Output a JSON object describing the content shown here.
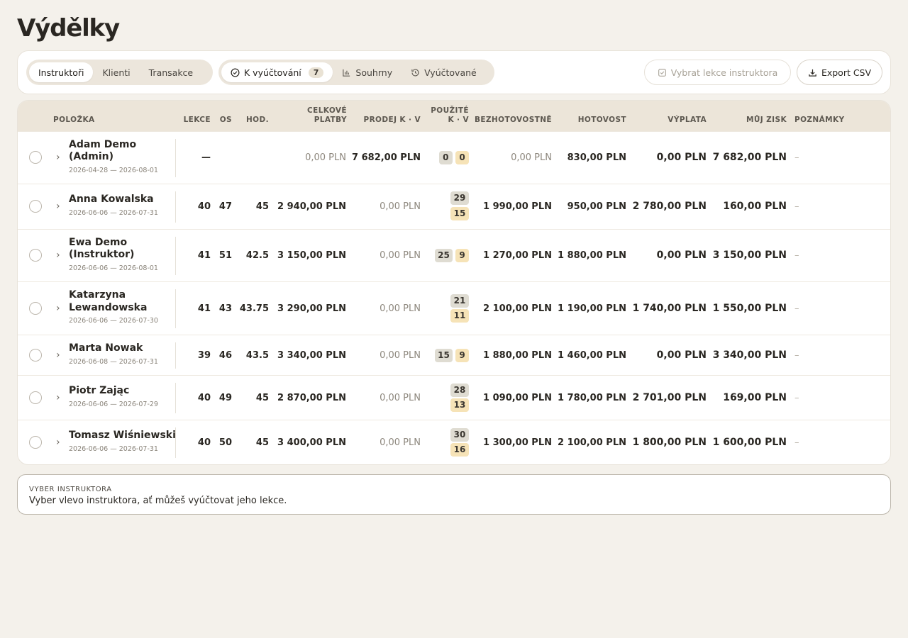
{
  "title": "Výdělky",
  "tabs_primary": [
    {
      "label": "Instruktoři",
      "active": true
    },
    {
      "label": "Klienti",
      "active": false
    },
    {
      "label": "Transakce",
      "active": false
    }
  ],
  "tabs_secondary": [
    {
      "label": "K vyúčtování",
      "count": "7",
      "icon": "check-circle-icon",
      "active": true
    },
    {
      "label": "Souhrny",
      "icon": "bar-chart-icon",
      "active": false
    },
    {
      "label": "Vyúčtované",
      "icon": "history-icon",
      "active": false
    }
  ],
  "actions": {
    "select_lessons": "Vybrat lekce instruktora",
    "export": "Export CSV"
  },
  "table": {
    "headers": {
      "item": "POLOŽKA",
      "lessons": "LEKCE",
      "os": "OS",
      "hours": "HOD.",
      "total_1": "CELKOVÉ",
      "total_2": "PLATBY",
      "sale": "PRODEJ K · V",
      "used_1": "POUŽITÉ",
      "used_2": "K · V",
      "cashless": "BEZHOTOVOSTNĚ",
      "cash": "HOTOVOST",
      "payout": "VÝPLATA",
      "profit": "MŮJ ZISK",
      "notes": "POZNÁMKY"
    },
    "rows": [
      {
        "name_1": "Adam Demo",
        "name_2": "(Admin)",
        "dates": "2026-04-28 — 2026-08-01",
        "lessons": "—",
        "os": "",
        "hours": "",
        "total": "0,00 PLN",
        "sale": "7 682,00 PLN",
        "used_k": "0",
        "used_v": "0",
        "cashless": "0,00 PLN",
        "cash": "830,00 PLN",
        "payout": "0,00 PLN",
        "profit": "7 682,00 PLN",
        "notes": "–"
      },
      {
        "name_1": "Anna Kowalska",
        "name_2": "",
        "dates": "2026-06-06 — 2026-07-31",
        "lessons": "40",
        "os": "47",
        "hours": "45",
        "total": "2 940,00 PLN",
        "sale": "0,00 PLN",
        "used_k": "29",
        "used_v": "15",
        "cashless": "1 990,00 PLN",
        "cash": "950,00 PLN",
        "payout": "2 780,00 PLN",
        "profit": "160,00 PLN",
        "notes": "–"
      },
      {
        "name_1": "Ewa Demo",
        "name_2": "(Instruktor)",
        "dates": "2026-06-06 — 2026-08-01",
        "lessons": "41",
        "os": "51",
        "hours": "42.5",
        "total": "3 150,00 PLN",
        "sale": "0,00 PLN",
        "used_k": "25",
        "used_v": "9",
        "cashless": "1 270,00 PLN",
        "cash": "1 880,00 PLN",
        "payout": "0,00 PLN",
        "profit": "3 150,00 PLN",
        "notes": "–"
      },
      {
        "name_1": "Katarzyna",
        "name_2": "Lewandowska",
        "dates": "2026-06-06 — 2026-07-30",
        "lessons": "41",
        "os": "43",
        "hours": "43.75",
        "total": "3 290,00 PLN",
        "sale": "0,00 PLN",
        "used_k": "21",
        "used_v": "11",
        "cashless": "2 100,00 PLN",
        "cash": "1 190,00 PLN",
        "payout": "1 740,00 PLN",
        "profit": "1 550,00 PLN",
        "notes": "–"
      },
      {
        "name_1": "Marta Nowak",
        "name_2": "",
        "dates": "2026-06-08 — 2026-07-31",
        "lessons": "39",
        "os": "46",
        "hours": "43.5",
        "total": "3 340,00 PLN",
        "sale": "0,00 PLN",
        "used_k": "15",
        "used_v": "9",
        "cashless": "1 880,00 PLN",
        "cash": "1 460,00 PLN",
        "payout": "0,00 PLN",
        "profit": "3 340,00 PLN",
        "notes": "–"
      },
      {
        "name_1": "Piotr Zając",
        "name_2": "",
        "dates": "2026-06-06 — 2026-07-29",
        "lessons": "40",
        "os": "49",
        "hours": "45",
        "total": "2 870,00 PLN",
        "sale": "0,00 PLN",
        "used_k": "28",
        "used_v": "13",
        "cashless": "1 090,00 PLN",
        "cash": "1 780,00 PLN",
        "payout": "2 701,00 PLN",
        "profit": "169,00 PLN",
        "notes": "–"
      },
      {
        "name_1": "Tomasz Wiśniewski",
        "name_2": "",
        "dates": "2026-06-06 — 2026-07-31",
        "lessons": "40",
        "os": "50",
        "hours": "45",
        "total": "3 400,00 PLN",
        "sale": "0,00 PLN",
        "used_k": "30",
        "used_v": "16",
        "cashless": "1 300,00 PLN",
        "cash": "2 100,00 PLN",
        "payout": "1 800,00 PLN",
        "profit": "1 600,00 PLN",
        "notes": "–"
      }
    ]
  },
  "hint": {
    "label": "VYBER INSTRUKTORA",
    "text": "Vyber vlevo instruktora, ať můžeš vyúčtovat jeho lekce."
  }
}
